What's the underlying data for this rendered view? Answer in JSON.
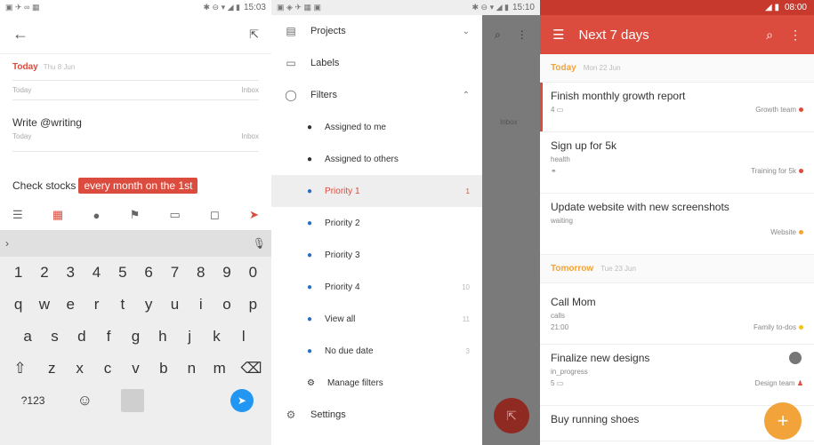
{
  "screen1": {
    "status_time": "15:03",
    "today_label": "Today",
    "today_date": "Thu 8 Jun",
    "row0_date": "Today",
    "row0_project": "Inbox",
    "task1_title": "Write @writing",
    "task1_date": "Today",
    "task1_project": "Inbox",
    "quick_text": "Check stocks",
    "quick_pill": "every month on the 1st",
    "keys_row1": [
      "1",
      "2",
      "3",
      "4",
      "5",
      "6",
      "7",
      "8",
      "9",
      "0"
    ],
    "keys_row2": [
      "q",
      "w",
      "e",
      "r",
      "t",
      "y",
      "u",
      "i",
      "o",
      "p"
    ],
    "keys_row3": [
      "a",
      "s",
      "d",
      "f",
      "g",
      "h",
      "j",
      "k",
      "l"
    ],
    "keys_row4": [
      "z",
      "x",
      "c",
      "v",
      "b",
      "n",
      "m"
    ],
    "key_symbols": "?123"
  },
  "screen2": {
    "status_time": "15:10",
    "projects": "Projects",
    "labels": "Labels",
    "filters": "Filters",
    "assigned_to_me": "Assigned to me",
    "assigned_to_others": "Assigned to others",
    "priority1": "Priority 1",
    "priority1_count": "1",
    "priority2": "Priority 2",
    "priority3": "Priority 3",
    "priority4": "Priority 4",
    "priority4_count": "10",
    "view_all": "View all",
    "view_all_count": "11",
    "no_due_date": "No due date",
    "no_due_date_count": "3",
    "manage_filters": "Manage filters",
    "settings": "Settings",
    "shade_label": "Inbox"
  },
  "screen3": {
    "status_time": "08:00",
    "title": "Next 7 days",
    "today_label": "Today",
    "today_date": "Mon 22 Jun",
    "tomorrow_label": "Tomorrow",
    "tomorrow_date": "Tue 23 Jun",
    "tasks": [
      {
        "title": "Finish monthly growth report",
        "label": "4",
        "project": "Growth team",
        "color": "#db4c3f"
      },
      {
        "title": "Sign up for 5k",
        "label": "health",
        "project": "Training for 5k",
        "color": "#db4c3f"
      },
      {
        "title": "Update website with new screenshots",
        "label": "waiting",
        "project": "Website",
        "color": "#f2a33a"
      },
      {
        "title": "Call Mom",
        "label": "calls",
        "time": "21:00",
        "project": "Family to-dos",
        "color": "#f2c21a"
      },
      {
        "title": "Finalize new designs",
        "label": "in_progress",
        "time": "5",
        "project": "Design team",
        "color": "#db4c3f"
      },
      {
        "title": "Buy running shoes",
        "label": "",
        "project": "",
        "color": ""
      }
    ]
  }
}
